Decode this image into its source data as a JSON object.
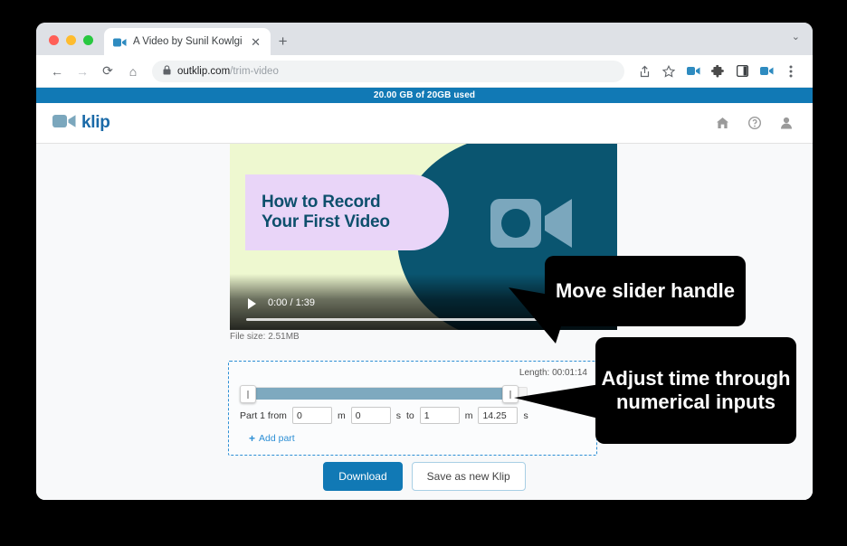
{
  "browser": {
    "tab": {
      "title": "A Video by Sunil Kowlgi",
      "favicon": "video-camera-icon",
      "close_label": "✕"
    },
    "new_tab_label": "+",
    "tabstrip_chevron": "⌄",
    "nav": {
      "back": "←",
      "forward": "→",
      "reload": "⟳",
      "home": "⌂"
    },
    "omnibox": {
      "url_domain": "outklip.com",
      "url_path": "/trim-video",
      "lock_icon": "lock-icon"
    },
    "toolbar_icons": [
      "share-icon",
      "bookmark-star-icon",
      "video-extension-icon",
      "puzzle-extension-icon",
      "side-panel-icon",
      "screen-recorder-icon",
      "kebab-menu-icon"
    ]
  },
  "page": {
    "storage_banner": "20.00 GB of 20GB used",
    "brand": {
      "name": "klip",
      "icon": "video-camera-icon"
    },
    "header_icons": [
      "home-icon",
      "help-icon",
      "user-account-icon"
    ],
    "video": {
      "thumbnail_title": "How to Record\nYour First Video",
      "thumbnail_icon": "video-camera-icon",
      "current_time": "0:00",
      "duration": "1:39",
      "time_display": "0:00 / 1:39",
      "play_icon": "play-icon",
      "volume_icon": "volume-icon",
      "file_size": "File size: 2.51MB"
    },
    "trim": {
      "length_label": "Length: 00:01:14",
      "part_label": "Part 1 from",
      "unit_minutes": "m",
      "unit_seconds": "s",
      "to_label": "to",
      "start_minutes": "0",
      "start_seconds": "0",
      "end_minutes": "1",
      "end_seconds": "14.25",
      "add_part_label": "Add part",
      "add_part_plus": "+"
    },
    "actions": {
      "download_label": "Download",
      "save_label": "Save as new Klip"
    }
  },
  "callouts": {
    "slider": "Move slider handle",
    "inputs": "Adjust time through numerical inputs"
  },
  "colors": {
    "brand_blue": "#1179b5",
    "banner_blue": "#1179b5",
    "thumb_teal": "#0a5570",
    "thumb_green": "#eef8d0",
    "thumb_lavender": "#e9d5f8",
    "slider_fill": "#7ea9bf",
    "dashed_border": "#2d8fd5",
    "callout_bg": "#000000"
  }
}
